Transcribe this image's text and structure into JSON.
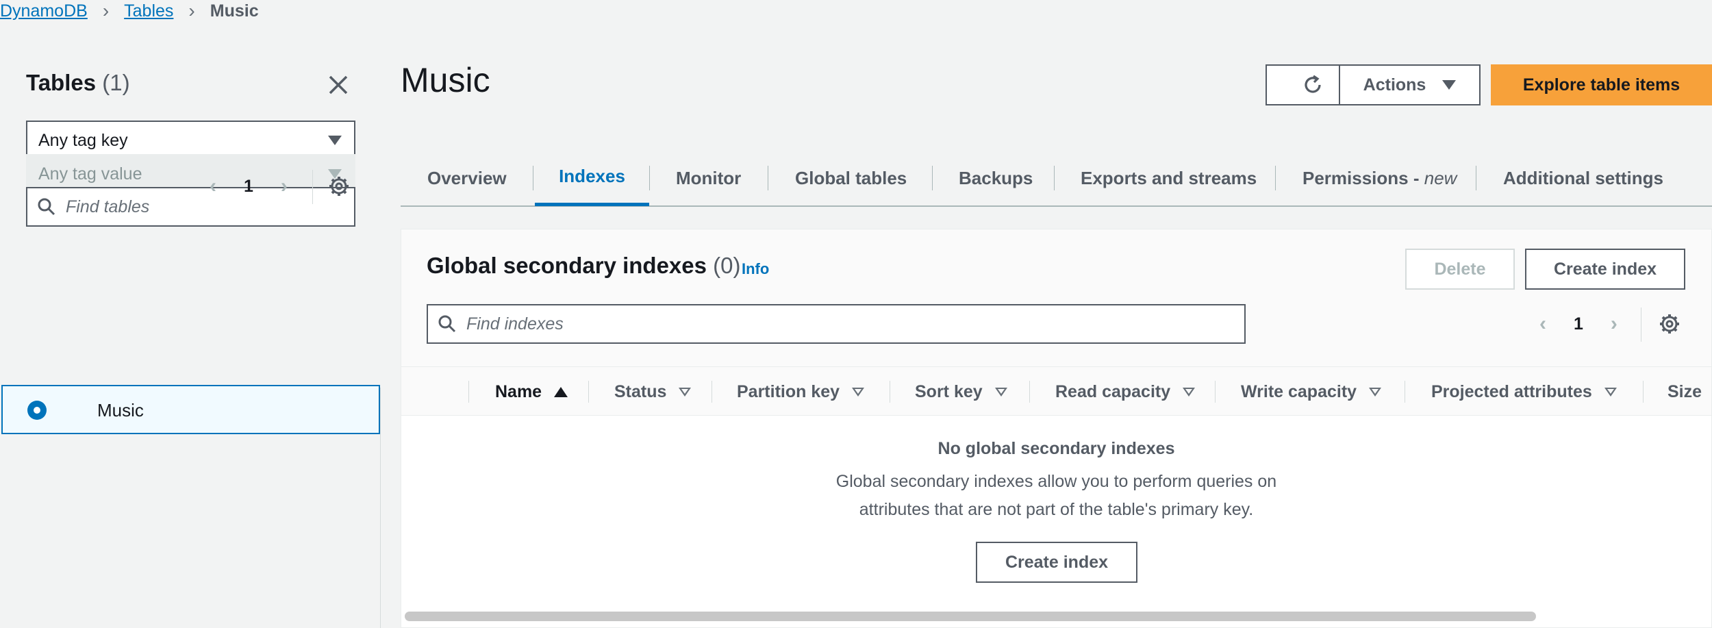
{
  "breadcrumb": {
    "items": [
      "DynamoDB",
      "Tables"
    ],
    "current": "Music"
  },
  "sidebar": {
    "title": "Tables",
    "count": "(1)",
    "tag_key_select": "Any tag key",
    "tag_value_select": "Any tag value",
    "search_placeholder": "Find tables",
    "page": "1",
    "tables": [
      {
        "label": "Music",
        "selected": true
      }
    ]
  },
  "main": {
    "title": "Music",
    "actions_label": "Actions",
    "explore_label": "Explore table items",
    "tabs": [
      {
        "label": "Overview"
      },
      {
        "label": "Indexes",
        "active": true
      },
      {
        "label": "Monitor"
      },
      {
        "label": "Global tables"
      },
      {
        "label": "Backups"
      },
      {
        "label": "Exports and streams"
      },
      {
        "label": "Permissions - ",
        "suffix": "new"
      },
      {
        "label": "Additional settings"
      }
    ],
    "gsi": {
      "title": "Global secondary indexes",
      "count": "(0)",
      "info": "Info",
      "delete_label": "Delete",
      "create_label": "Create index",
      "search_placeholder": "Find indexes",
      "page": "1",
      "columns": [
        "Name",
        "Status",
        "Partition key",
        "Sort key",
        "Read capacity",
        "Write capacity",
        "Projected attributes",
        "Size"
      ],
      "empty_title": "No global secondary indexes",
      "empty_line1": "Global secondary indexes allow you to perform queries on",
      "empty_line2": "attributes that are not part of the table's primary key.",
      "empty_create_label": "Create index"
    }
  },
  "colors": {
    "link": "#0073bb",
    "primary_button": "#f7a13a",
    "selected_row_bg": "#f1faff"
  }
}
